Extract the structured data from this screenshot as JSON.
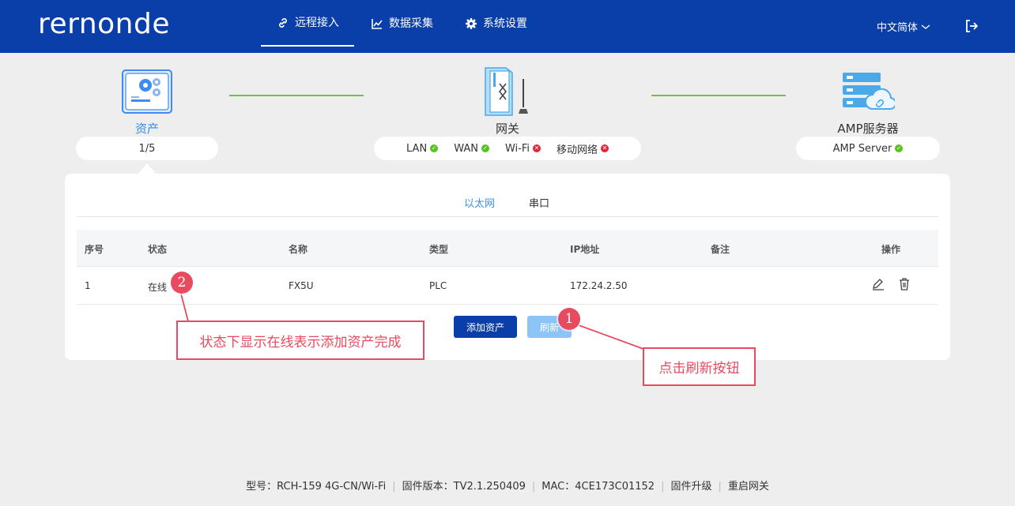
{
  "header": {
    "logo": "rernonde",
    "nav": [
      {
        "label": "远程接入",
        "icon": "link-icon",
        "active": true
      },
      {
        "label": "数据采集",
        "icon": "chart-line-icon",
        "active": false
      },
      {
        "label": "系统设置",
        "icon": "gear-icon",
        "active": false
      }
    ],
    "language": "中文简体",
    "logout_icon": "logout-icon",
    "background": "#0a3ea8"
  },
  "topology": {
    "asset": {
      "label": "资产",
      "count": "1/5",
      "icon": "asset-settings-icon"
    },
    "gateway": {
      "label": "网关",
      "icon": "gateway-device-icon",
      "statuses": [
        {
          "name": "LAN",
          "state": "ok"
        },
        {
          "name": "WAN",
          "state": "ok"
        },
        {
          "name": "Wi-Fi",
          "state": "error"
        },
        {
          "name": "移动网络",
          "state": "error"
        }
      ]
    },
    "server": {
      "label": "AMP服务器",
      "status_name": "AMP Server",
      "state": "ok",
      "icon": "cloud-server-icon"
    },
    "line_color": "#6dc24a"
  },
  "panel": {
    "tabs": [
      {
        "label": "以太网",
        "active": true
      },
      {
        "label": "串口",
        "active": false
      }
    ],
    "columns": [
      "序号",
      "状态",
      "名称",
      "类型",
      "IP地址",
      "备注",
      "操作"
    ],
    "rows": [
      {
        "index": "1",
        "status": "在线",
        "name": "FX5U",
        "type": "PLC",
        "ip": "172.24.2.50",
        "note": ""
      }
    ],
    "add_button": "添加资产",
    "refresh_button": "刷新"
  },
  "annotations": {
    "badge1": "1",
    "badge2": "2",
    "callout1": "点击刷新按钮",
    "callout2": "状态下显示在线表示添加资产完成",
    "color": "#e84a5f"
  },
  "footer": {
    "model": "型号：RCH-159  4G-CN/Wi-Fi",
    "firmware": "固件版本：TV2.1.250409",
    "mac": "MAC：4CE173C01152",
    "upgrade": "固件升级",
    "reboot": "重启网关"
  }
}
